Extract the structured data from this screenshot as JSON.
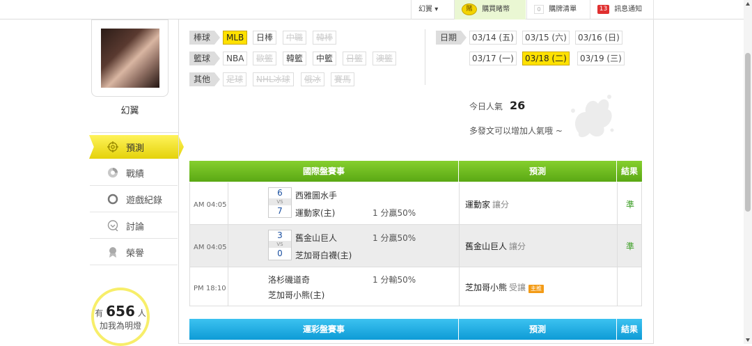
{
  "topbar": {
    "user": "幻翼",
    "user_arrow": "▾",
    "coin_label": "賭",
    "buy_coins": "購買睹幣",
    "cart_count": "0",
    "cart": "購牌清單",
    "msg_count": "13",
    "messages": "訊息通知"
  },
  "profile": {
    "username": "幻翼"
  },
  "sidebar": {
    "items": [
      {
        "label": "預測",
        "icon": "target-icon"
      },
      {
        "label": "戰績",
        "icon": "chart-icon"
      },
      {
        "label": "遊戲紀錄",
        "icon": "record-icon"
      },
      {
        "label": "討論",
        "icon": "discussion-icon"
      },
      {
        "label": "榮譽",
        "icon": "medal-icon"
      }
    ]
  },
  "fans": {
    "prefix": "有",
    "count": "656",
    "suffix": "人",
    "subtitle": "加我為明燈"
  },
  "filters": {
    "baseball": {
      "label": "棒球",
      "options": [
        "MLB",
        "日棒",
        "中職",
        "韓棒"
      ]
    },
    "basketball": {
      "label": "籃球",
      "options": [
        "NBA",
        "歐籃",
        "韓籃",
        "中籃",
        "日籃",
        "澳籃"
      ]
    },
    "other": {
      "label": "其他",
      "options": [
        "足球",
        "NHL冰球",
        "俄冰",
        "賽馬"
      ]
    }
  },
  "dates": {
    "label": "日期",
    "items": [
      "03/14 (五)",
      "03/15 (六)",
      "03/16 (日)",
      "03/17 (一)",
      "03/18 (二)",
      "03/19 (三)"
    ],
    "selected": "03/18 (二)"
  },
  "popularity": {
    "label": "今日人氣",
    "value": "26",
    "hint": "多發文可以增加人氣哦 ~"
  },
  "intl_table": {
    "title": "國際盤賽事",
    "col_pred": "預測",
    "col_result": "結果",
    "rows": [
      {
        "time": "AM 04:05",
        "score_top": "6",
        "vs": "VS",
        "score_bot": "7",
        "team_a": "西雅圖水手",
        "team_b": "運動家(主)",
        "line": "1 分贏50%",
        "pick": "運動家",
        "pick_type": "讓分",
        "result": "準"
      },
      {
        "time": "AM 04:05",
        "score_top": "3",
        "vs": "VS",
        "score_bot": "0",
        "team_a": "舊金山巨人",
        "team_b": "芝加哥白襪(主)",
        "line": "1 分贏50%",
        "pick": "舊金山巨人",
        "pick_type": "讓分",
        "result": "準"
      },
      {
        "time": "PM 18:10",
        "team_a": "洛杉磯道奇",
        "team_b": "芝加哥小熊(主)",
        "line": "1 分輸50%",
        "pick": "芝加哥小熊",
        "pick_type": "受讓",
        "badge": "主推",
        "result": ""
      }
    ]
  },
  "lottery_table": {
    "title": "運彩盤賽事",
    "col_pred": "預測",
    "col_result": "結果"
  }
}
